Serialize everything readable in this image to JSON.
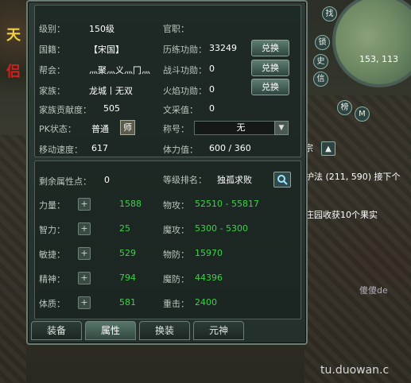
{
  "panel": {
    "fields": [
      {
        "label": "级别：",
        "value": "150级"
      },
      {
        "label": "官职：",
        "value": ""
      },
      {
        "label": "国籍：",
        "value": "【宋国】"
      },
      {
        "label": "历练功勋：",
        "value": "33249"
      },
      {
        "label": "帮会：",
        "value": "灬聚灬义灬冂灬"
      },
      {
        "label": "战斗功勋：",
        "value": "0"
      },
      {
        "label": "家族：",
        "value": "龙城丨无双"
      },
      {
        "label": "火焰功勋：",
        "value": "0"
      },
      {
        "label": "家族贡献度：",
        "value": "505"
      },
      {
        "label": "文采值：",
        "value": "0"
      },
      {
        "label": "PK状态：",
        "value": "普通"
      },
      {
        "label": "称号：",
        "value": "无"
      },
      {
        "label": "移动速度：",
        "value": "617"
      },
      {
        "label": "体力值：",
        "value": "600 / 360"
      }
    ],
    "exchange_label": "兑换",
    "shi_label": "师",
    "remaining_points_label": "剩余属性点：",
    "remaining_points_value": "0",
    "rank_label": "等级排名：",
    "rank_value": "独孤求败",
    "attributes": [
      {
        "label": "力量：",
        "value": "1588"
      },
      {
        "label": "智力：",
        "value": "25"
      },
      {
        "label": "敏捷：",
        "value": "529"
      },
      {
        "label": "精神：",
        "value": "794"
      },
      {
        "label": "体质：",
        "value": "581"
      }
    ],
    "combat": [
      {
        "label": "物攻：",
        "value": "52510 - 55817"
      },
      {
        "label": "魔攻：",
        "value": "5300 - 5300"
      },
      {
        "label": "物防：",
        "value": "15970"
      },
      {
        "label": "魔防：",
        "value": "44396"
      },
      {
        "label": "重击：",
        "value": "2400"
      }
    ],
    "tabs": [
      "装备",
      "属性",
      "换装",
      "元神"
    ],
    "active_tab": "属性"
  },
  "minimap": {
    "coords": "153, 113",
    "buttons": [
      "找",
      "锁",
      "史",
      "信",
      "M",
      "榜"
    ]
  },
  "chat": {
    "line1": "护法 (211, 590) 接下个",
    "line2": "庄园收获10个果实",
    "line3": "宗",
    "line4": "傻傻de"
  },
  "banner": {
    "left1": "天",
    "left2": "侣"
  },
  "watermark": "tu.duowan.c",
  "colors": {
    "accent": "#3fd14a",
    "panel": "#2d3a35"
  }
}
